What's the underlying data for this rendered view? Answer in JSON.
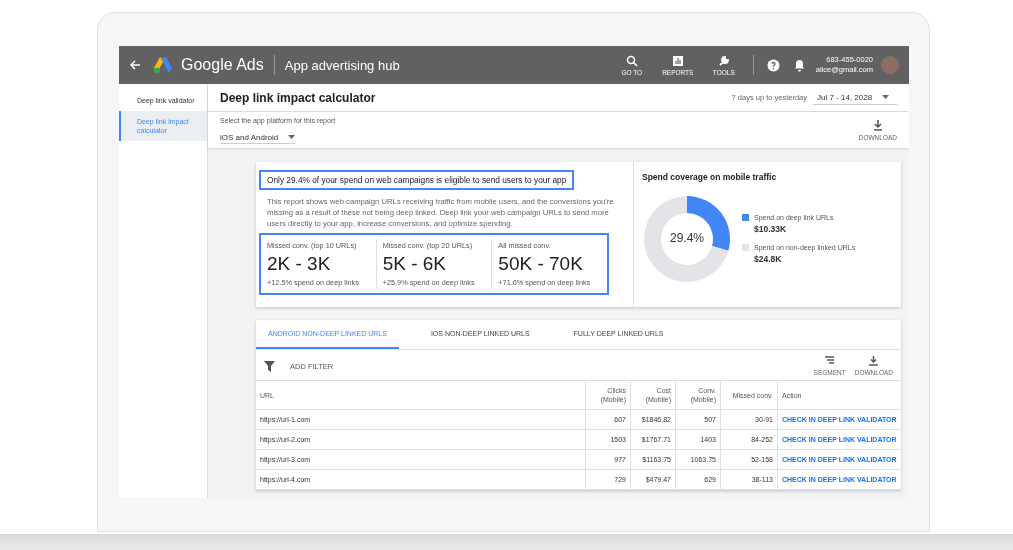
{
  "topbar": {
    "product": "Google Ads",
    "title": "App advertising hub",
    "tools": [
      {
        "kind": "search",
        "label": "GO TO"
      },
      {
        "kind": "reports",
        "label": "REPORTS"
      },
      {
        "kind": "tools",
        "label": "TOOLS"
      }
    ],
    "account": {
      "phone": "683-455-0020",
      "email": "alice@gmail.com"
    }
  },
  "sidebar": {
    "items": [
      {
        "label": "Deep link validator",
        "selected": false
      },
      {
        "label": "Deep link impact calculator",
        "selected": true
      }
    ]
  },
  "page": {
    "title": "Deep link impact calculator",
    "range_label": "7 days up to yesterday",
    "date": "Jul 7 - 14, 2028",
    "platform_label": "Select the app platform for this report",
    "platform": "iOS and Android",
    "download": "DOWNLOAD"
  },
  "summary": {
    "headline": "Only 29.4% of your spend on web campaigns is eligible to send users to your app",
    "body": "This report shows web campaign URLs receiving traffic from mobile users, and the conversions you're missing as a result of these not being deep linked. Deep link your web campaign URLs to send more users directly to your app, increase conversions, and optimize spending.",
    "metrics": [
      {
        "label": "Missed conv. (top 10 URLs)",
        "value": "2K - 3K",
        "note": "+12.5% spend on deep links"
      },
      {
        "label": "Missed conv. (top 20 URLs)",
        "value": "5K - 6K",
        "note": "+25.9% spend on deep links"
      },
      {
        "label": "All missed conv.",
        "value": "50K - 70K",
        "note": "+71.6% spend on deep links"
      }
    ]
  },
  "coverage": {
    "title": "Spend coverage on mobile traffic",
    "center": "29.4%",
    "legend": [
      {
        "value": "$10.33K",
        "color": "#4285f4"
      },
      {
        "value": "$24.8K",
        "color": "#e3e4e7"
      }
    ],
    "chart_data": {
      "type": "donut",
      "categories": [
        "Spend on deep link URLs",
        "Spend on non-deep linked URLs"
      ],
      "values": [
        29.4,
        70.6
      ]
    }
  },
  "report": {
    "tabs": [
      {
        "label": "ANDROID NON-DEEP LINKED URLS",
        "selected": true
      },
      {
        "label": "IOS NON-DEEP LINKED URLS",
        "selected": false
      },
      {
        "label": "FULLY DEEP LINKED URLS",
        "selected": false
      }
    ],
    "filter": "ADD FILTER",
    "actions": [
      {
        "kind": "segment",
        "label": "SEGMENT"
      },
      {
        "kind": "download",
        "label": "DOWNLOAD"
      }
    ],
    "columns": [
      "URL",
      "Clicks (Mobile)",
      "Cost (Mobile)",
      "Conv. (Mobile)",
      "Missed conv.",
      "Action"
    ],
    "rows": [
      [
        "https://url-1.com",
        "607",
        "$1846.82",
        "507",
        "30-91",
        "CHECK IN DEEP LINK VALIDATOR"
      ],
      [
        "https://url-2.com",
        "1503",
        "$1767.71",
        "1403",
        "84-252",
        "CHECK IN DEEP LINK VALIDATOR"
      ],
      [
        "https://url-3.com",
        "977",
        "$1163.75",
        "1063.75",
        "52-158",
        "CHECK IN DEEP LINK VALIDATOR"
      ],
      [
        "https://url-4.com",
        "729",
        "$479.47",
        "629",
        "38-113",
        "CHECK IN DEEP LINK VALIDATOR"
      ]
    ]
  }
}
